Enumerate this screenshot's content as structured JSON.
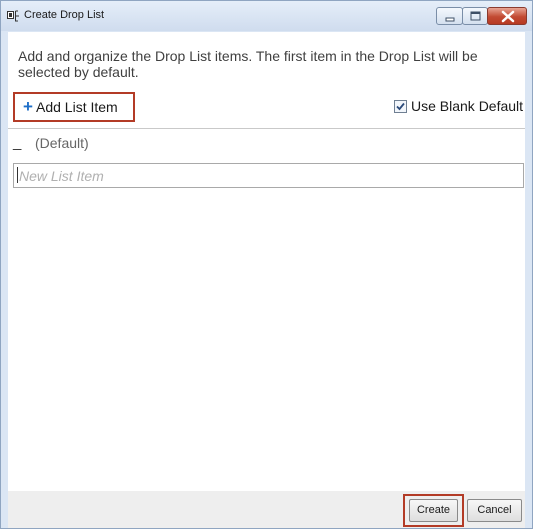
{
  "window": {
    "title": "Create Drop List",
    "controls": [
      "minimize-icon",
      "maximize-icon",
      "close-icon"
    ],
    "accent": "#b33b26"
  },
  "description": "Add and organize the Drop List items. The first item in the Drop List will be selected by default.",
  "toolbar": {
    "add_icon": "plus",
    "add_label": "Add List Item",
    "blank_default_label": "Use Blank Default",
    "blank_default_checked": true
  },
  "list": {
    "items": [
      {
        "marker": "_",
        "label": "(Default)"
      }
    ],
    "new_item_placeholder": "New List Item"
  },
  "buttons": {
    "create_label": "Create",
    "cancel_label": "Cancel"
  }
}
